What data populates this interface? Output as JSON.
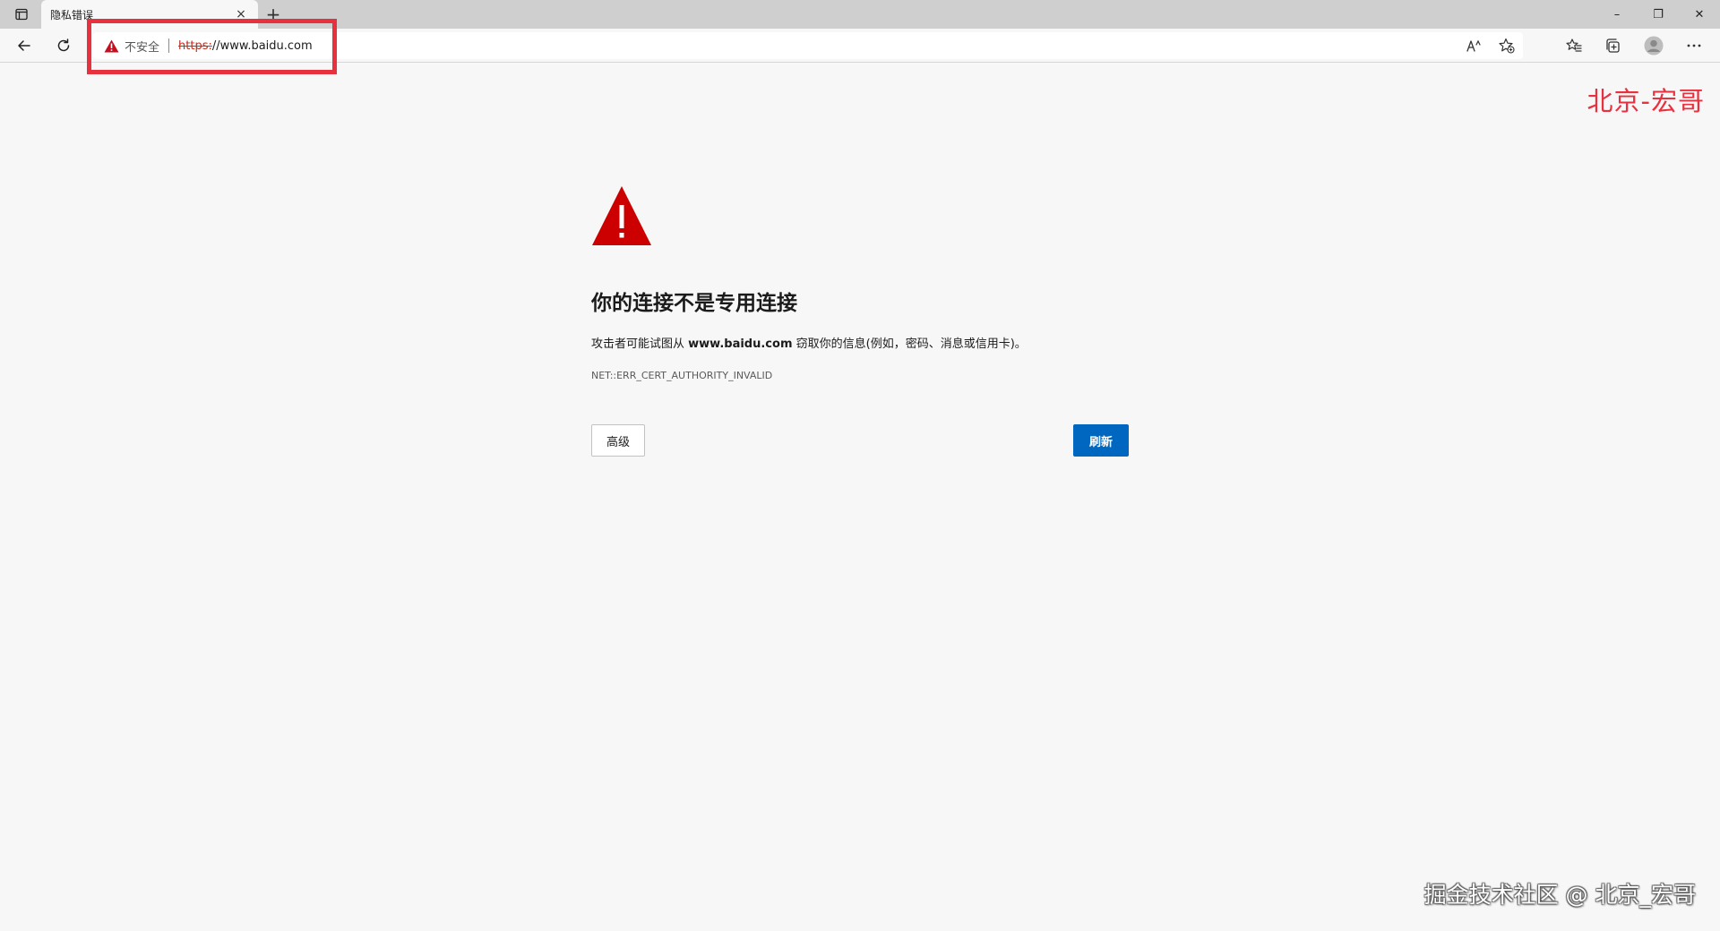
{
  "browser": {
    "tab": {
      "title": "隐私错误",
      "close": "×"
    },
    "new_tab": "+",
    "window": {
      "minimize": "–",
      "restore": "❐",
      "close": "✕"
    },
    "address": {
      "security_label": "不安全",
      "url_scheme": "https:",
      "url_rest": "//www.baidu.com"
    },
    "toolbar_icons": [
      "back-icon",
      "refresh-icon",
      "read-aloud-icon",
      "add-favorite-icon",
      "favorites-icon",
      "collections-icon",
      "profile-icon",
      "more-icon"
    ]
  },
  "page": {
    "title": "你的连接不是专用连接",
    "description_prefix": "攻击者可能试图从 ",
    "description_domain": "www.baidu.com",
    "description_suffix": " 窃取你的信息(例如，密码、消息或信用卡)。",
    "error_code": "NET::ERR_CERT_AUTHORITY_INVALID",
    "advanced_button": "高级",
    "refresh_button": "刷新"
  },
  "watermarks": {
    "top_right": "北京-宏哥",
    "bottom_right": "掘金技术社区 @ 北京_宏哥"
  },
  "colors": {
    "warning_red": "#cc0000",
    "highlight_red": "#e8313f",
    "primary_blue": "#0067c0",
    "insecure_scheme": "#c42b1c"
  }
}
